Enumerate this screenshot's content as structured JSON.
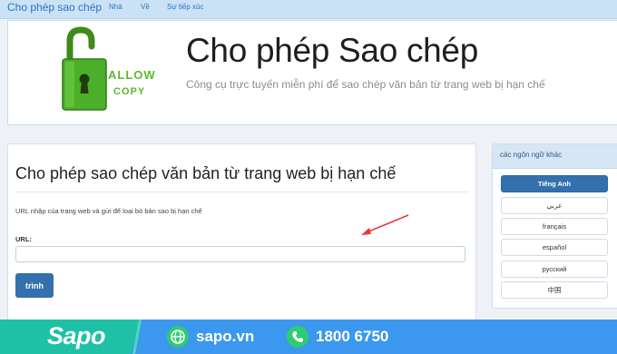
{
  "nav": {
    "brand": "Cho phép sao chép",
    "items": [
      "Nhà",
      "Về",
      "Sự tiếp xúc"
    ]
  },
  "header": {
    "logo_text_line1": "ALLOW",
    "logo_text_line2": "COPY",
    "title": "Cho phép Sao chép",
    "subtitle": "Công cụ trực tuyến miễn phí để sao chép văn bản từ trang web bị hạn chế"
  },
  "main": {
    "heading": "Cho phép sao chép văn bản từ trang web bị hạn chế",
    "description": "URL nhập của trang web và gửi để loại bỏ bản sao bị hạn chế",
    "url_label": "URL:",
    "url_value": "",
    "submit_label": "trình"
  },
  "languages": {
    "header": "các ngôn ngữ khác",
    "items": [
      "Tiếng Anh",
      "عربي",
      "français",
      "español",
      "русский",
      "中国"
    ]
  },
  "banner": {
    "brand": "Sapo",
    "website": "sapo.vn",
    "phone": "1800 6750"
  },
  "colors": {
    "primary": "#3370ad",
    "nav_bg": "#c9e2f6",
    "banner_blue": "#3b98ee",
    "banner_green": "#1ec1a5",
    "arrow": "#e53935"
  }
}
